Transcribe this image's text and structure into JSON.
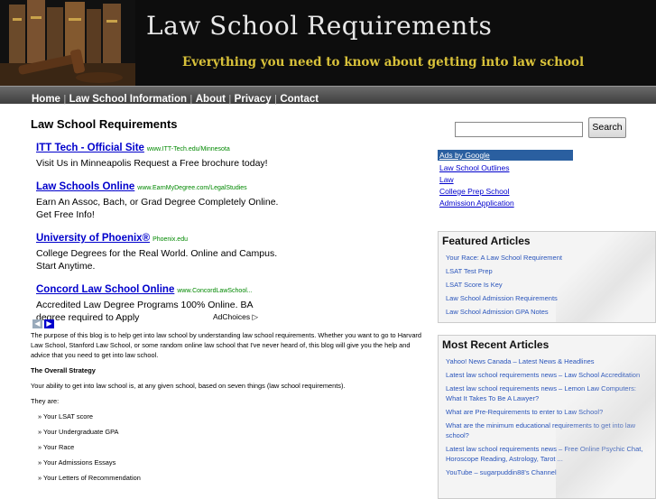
{
  "banner": {
    "title": "Law School Requirements",
    "tagline": "Everything you need to know about getting into law school"
  },
  "nav": [
    "Home",
    "Law School Information",
    "About",
    "Privacy",
    "Contact"
  ],
  "page_title": "Law School Requirements",
  "ads": [
    {
      "title": "ITT Tech - Official Site",
      "url": "www.ITT-Tech.edu/Minnesota",
      "desc": "Visit Us in Minneapolis Request a Free brochure today!"
    },
    {
      "title": "Law Schools Online",
      "url": "www.EarnMyDegree.com/LegalStudies",
      "desc": "Earn An Assoc, Bach, or Grad Degree Completely Online. Get Free Info!"
    },
    {
      "title": "University of Phoenix®",
      "url": "Phoenix.edu",
      "desc": "College Degrees for the Real World. Online and Campus. Start Anytime."
    },
    {
      "title": "Concord Law School Online",
      "url": "www.ConcordLawSchool...",
      "desc": "Accredited Law Degree Programs 100% Online. BA degree required to Apply"
    }
  ],
  "adchoices": "AdChoices",
  "article": {
    "intro": "The purpose of this blog is to help get into law school by understanding law school requirements.  Whether you want to go to Harvard Law School, Stanford Law School, or some random online law school that I've never heard of, this blog will give you the help and advice that you need to get into law school.",
    "heading": "The Overall Strategy",
    "p2": "Your ability to get into law school is, at any given school, based on seven things (law school requirements).",
    "p3": "They are:",
    "items": [
      "» Your LSAT score",
      "» Your Undergraduate GPA",
      "» Your Race",
      "» Your Admissions Essays",
      "» Your Letters of Recommendation"
    ]
  },
  "search": {
    "button": "Search",
    "value": ""
  },
  "google_ads": {
    "header": "Ads by Google",
    "links": [
      "Law School Outlines",
      "Law",
      "College Prep School",
      "Admission Application"
    ]
  },
  "featured": {
    "title": "Featured Articles",
    "links": [
      "Your Race: A Law School Requirement",
      "LSAT Test Prep",
      "LSAT Score Is Key",
      "Law School Admission Requirements",
      "Law School Admission GPA Notes"
    ]
  },
  "recent": {
    "title": "Most Recent Articles",
    "links": [
      "Yahoo! News Canada – Latest News & Headlines",
      "Latest law school requirements news – Law School Accreditation",
      "Latest law school requirements news – Lemon Law Computers: What It Takes To Be A Lawyer?",
      "What are Pre-Requirements to enter to Law School?",
      "What are the minimum educational requirements to get into law school?",
      "Latest law school requirements news – Free Online Psychic Chat, Horoscope Reading, Astrology, Tarot ...",
      "YouTube – sugarpuddin88's Channel"
    ]
  }
}
